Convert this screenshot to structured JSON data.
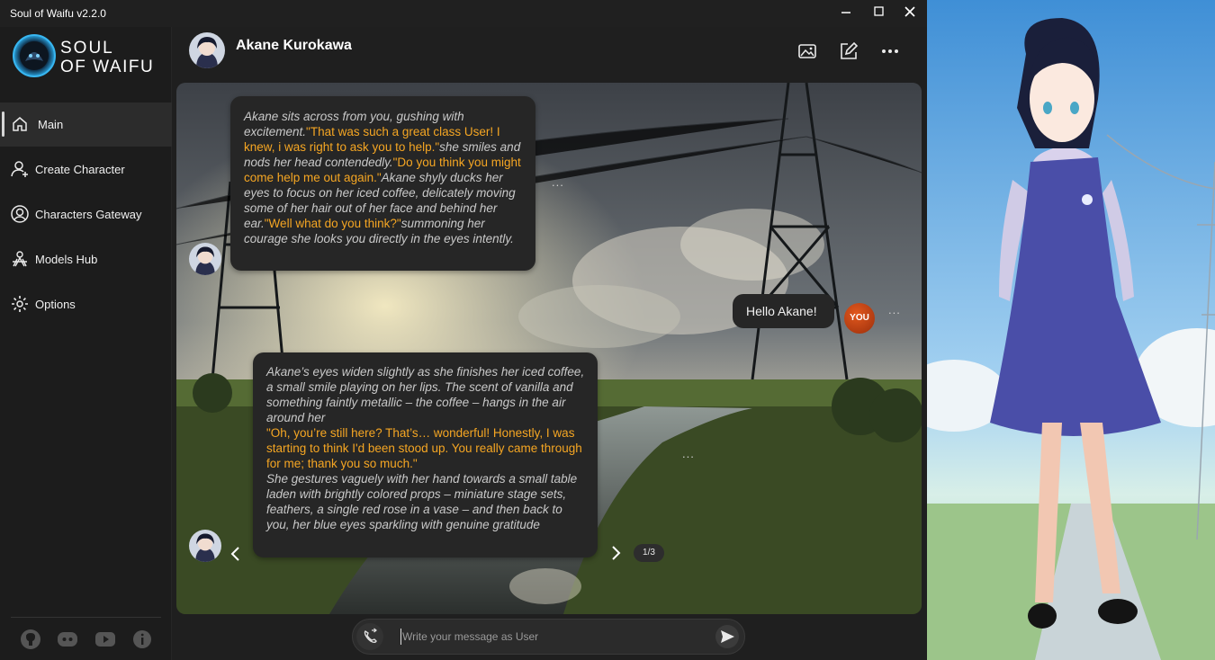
{
  "window": {
    "title": "Soul of Waifu v2.2.0",
    "controls": [
      "minimize-icon",
      "maximize-icon",
      "close-icon"
    ]
  },
  "sidebar": {
    "logo": {
      "line1": "SOUL",
      "line2": "OF WAIFU"
    },
    "items": [
      {
        "label": "Main",
        "icon": "home-icon",
        "active": true
      },
      {
        "label": "Create Character",
        "icon": "add-user-icon",
        "active": false
      },
      {
        "label": "Characters Gateway",
        "icon": "user-circle-icon",
        "active": false
      },
      {
        "label": "Models Hub",
        "icon": "models-hub-icon",
        "active": false
      },
      {
        "label": "Options",
        "icon": "settings-icon",
        "active": false
      }
    ],
    "social": [
      "github-icon",
      "discord-icon",
      "youtube-icon",
      "info-icon"
    ]
  },
  "chat_header": {
    "character_name": "Akane Kurokawa",
    "actions": [
      "image-icon",
      "edit-icon",
      "more-icon"
    ]
  },
  "messages": [
    {
      "sender": "character",
      "segments": [
        {
          "style": "narration",
          "text": "Akane sits across from you, gushing with excitement."
        },
        {
          "style": "speech",
          "text": "\"That was such a great class User! I knew, i was right to ask you to help.\""
        },
        {
          "style": "narration",
          "text": "she smiles and nods her head contendedly."
        },
        {
          "style": "speech",
          "text": "\"Do you think you might come help me out again.\""
        },
        {
          "style": "narration",
          "text": "Akane shyly ducks her eyes to focus on her iced coffee, delicately moving some of her hair out of her face and behind her ear."
        },
        {
          "style": "speech",
          "text": "\"Well what do you think?\""
        },
        {
          "style": "narration",
          "text": "summoning her courage she looks you directly in the eyes intently."
        }
      ]
    },
    {
      "sender": "user",
      "avatar_label": "YOU",
      "text": "Hello Akane!"
    },
    {
      "sender": "character",
      "segments": [
        {
          "style": "narration",
          "text": "Akane’s eyes widen slightly as she finishes her iced coffee, a small smile playing on her lips. The scent of vanilla and something faintly metallic – the coffee – hangs in the air around her"
        },
        {
          "style": "speech",
          "text": "\"Oh, you’re still here? That’s… wonderful! Honestly, I was starting to think I'd been stood up. You really came through for me; thank you so much.\""
        },
        {
          "style": "narration",
          "text": "She gestures vaguely with her hand towards a small table laden with brightly colored props – miniature stage sets, feathers, a single red rose in a vase – and then back to you, her blue eyes sparkling with genuine gratitude"
        }
      ],
      "pagination": "1/3"
    }
  ],
  "message_menu_label": "...",
  "composer": {
    "placeholder": "Write your message as User",
    "value": ""
  },
  "colors": {
    "speech": "#f5a623",
    "narration": "#c9c9c9",
    "bubble": "#262626",
    "sidebar_active": "#2c2c2c",
    "user_avatar": "#c0461a"
  }
}
